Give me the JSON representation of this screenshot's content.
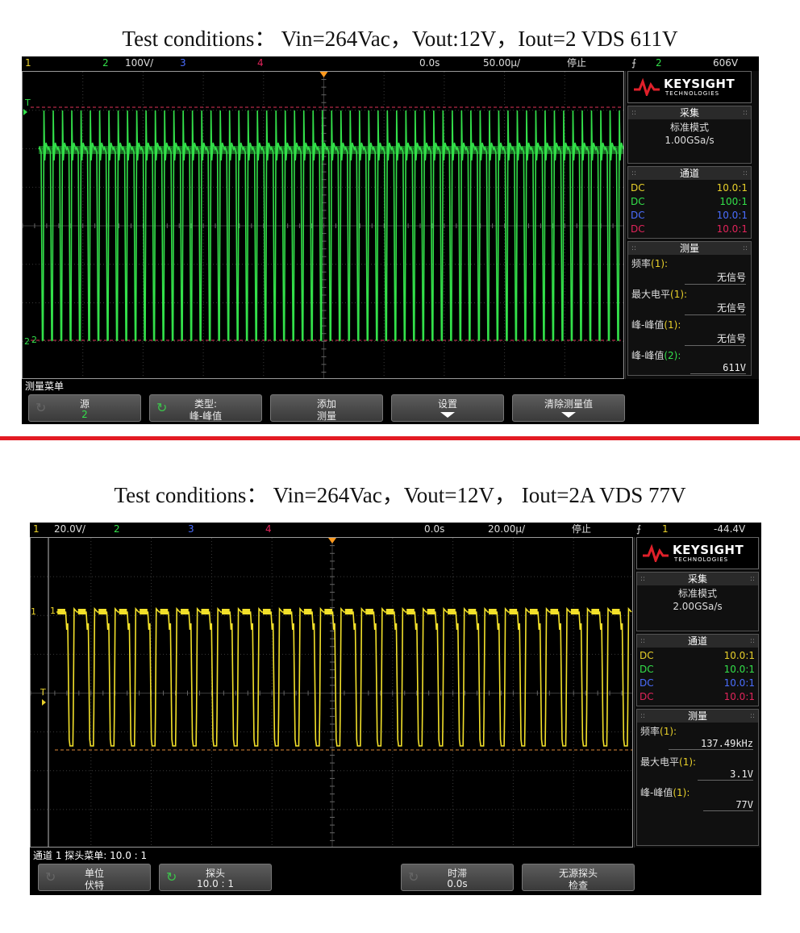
{
  "scope1": {
    "caption": "Test conditions： Vin=264Vac，Vout:12V，Iout=2  VDS 611V",
    "waveform_color": "#33e04a",
    "topbar": {
      "ch1": "1",
      "ch2": "2",
      "ch2_scale": "100V/",
      "ch3": "3",
      "ch4": "4",
      "time_delay": "0.0s",
      "time_scale": "50.00µ/",
      "run_state": "停止",
      "trigger_icon": "⨍",
      "trigger_source": "2",
      "trigger_level": "606V"
    },
    "markers": {
      "trigger": "T",
      "ground": "2",
      "ground2": "2"
    },
    "side": {
      "brand": "KEYSIGHT",
      "brand_sub": "TECHNOLOGIES",
      "acq_title": "采集",
      "acq_mode": "标准模式",
      "acq_rate": "1.00GSa/s",
      "channels_title": "通道",
      "channels": [
        {
          "coupling": "DC",
          "probe": "10.0:1",
          "color": "#e8d02a"
        },
        {
          "coupling": "DC",
          "probe": "100:1",
          "color": "#33e04a"
        },
        {
          "coupling": "DC",
          "probe": "10.0:1",
          "color": "#4a6dff"
        },
        {
          "coupling": "DC",
          "probe": "10.0:1",
          "color": "#e0245a"
        }
      ],
      "meas_title": "测量",
      "measurements": [
        {
          "name": "频率",
          "ch": "(1):",
          "value": "无信号"
        },
        {
          "name": "最大电平",
          "ch": "(1):",
          "value": "无信号"
        },
        {
          "name": "峰-峰值",
          "ch": "(1):",
          "value": "无信号"
        },
        {
          "name": "峰-峰值",
          "ch": "(2):",
          "value": "611V"
        }
      ]
    },
    "menu_title": "测量菜单",
    "softkeys": [
      {
        "line1": "源",
        "line2": "2",
        "rot": "dim"
      },
      {
        "line1": "类型:",
        "line2": "峰-峰值",
        "rot": "on"
      },
      {
        "line1": "添加",
        "line2": "测量",
        "rot": ""
      },
      {
        "line1": "设置",
        "line2": "",
        "rot": "",
        "arrow": true
      },
      {
        "line1": "清除测量值",
        "line2": "",
        "rot": "",
        "arrow": true
      }
    ]
  },
  "scope2": {
    "caption": "Test conditions： Vin=264Vac，Vout=12V， Iout=2A VDS 77V",
    "waveform_color": "#f2e02a",
    "topbar": {
      "ch1": "1",
      "ch1_scale": "20.0V/",
      "ch2": "2",
      "ch3": "3",
      "ch4": "4",
      "time_delay": "0.0s",
      "time_scale": "20.00µ/",
      "run_state": "停止",
      "trigger_icon": "⨍",
      "trigger_source": "1",
      "trigger_level": "-44.4V"
    },
    "markers": {
      "trigger": "T",
      "ground": "1",
      "ground2": "1"
    },
    "side": {
      "brand": "KEYSIGHT",
      "brand_sub": "TECHNOLOGIES",
      "acq_title": "采集",
      "acq_mode": "标准模式",
      "acq_rate": "2.00GSa/s",
      "channels_title": "通道",
      "channels": [
        {
          "coupling": "DC",
          "probe": "10.0:1",
          "color": "#e8d02a"
        },
        {
          "coupling": "DC",
          "probe": "10.0:1",
          "color": "#33e04a"
        },
        {
          "coupling": "DC",
          "probe": "10.0:1",
          "color": "#4a6dff"
        },
        {
          "coupling": "DC",
          "probe": "10.0:1",
          "color": "#e0245a"
        }
      ],
      "meas_title": "测量",
      "measurements": [
        {
          "name": "频率",
          "ch": "(1):",
          "value": "137.49kHz"
        },
        {
          "name": "最大电平",
          "ch": "(1):",
          "value": "3.1V"
        },
        {
          "name": "峰-峰值",
          "ch": "(1):",
          "value": "77V"
        }
      ]
    },
    "menu_title": "通道 1 探头菜单: 10.0 : 1",
    "softkeys": [
      {
        "line1": "单位",
        "line2": "伏特",
        "rot": "dim"
      },
      {
        "line1": "探头",
        "line2": "10.0 : 1",
        "rot": "on"
      },
      {
        "line1": "时滞",
        "line2": "0.0s",
        "rot": "dim"
      },
      {
        "line1": "无源探头",
        "line2": "检查",
        "rot": ""
      }
    ]
  }
}
